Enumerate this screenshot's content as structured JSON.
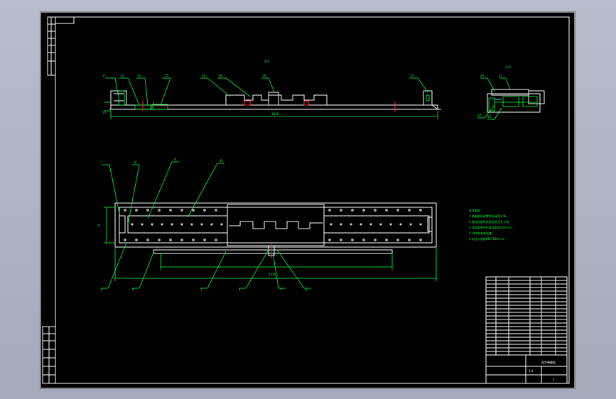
{
  "colors": {
    "background": "#000000",
    "outline": "#ffffff",
    "leader": "#00ff3c",
    "centerline": "#ff2a2a",
    "viewport": "#a9b0bf"
  },
  "top_view": {
    "section_label": "A-A",
    "part_callouts": [
      "17",
      "13",
      "14",
      "15",
      "16",
      "18",
      "19",
      "10",
      "13"
    ],
    "length_dim": "1426"
  },
  "side_section": {
    "label": "B-B",
    "part_callouts": [
      "20",
      "21",
      "22",
      "23"
    ]
  },
  "plan_view": {
    "part_callouts_top": [
      "2",
      "8",
      "9",
      "11"
    ],
    "part_callouts_bottom": [
      "4",
      "5",
      "1",
      "3",
      "7",
      "6"
    ],
    "left_dim": "B",
    "length_dim": "1426"
  },
  "tech_notes": {
    "title": "技术要求",
    "lines": [
      "1.装配前所有零件应清洗干净。",
      "2.各运动部件应运动灵活无卡滞。",
      "3.导轨安装平行度误差≤0.02mm。",
      "4.同步带张紧适度。",
      "5.未注公差按GB/T1804-m。"
    ]
  },
  "title_block": {
    "row_count": 22,
    "drawing_name": "同步带模组",
    "scale": "1:2",
    "sheet": "1"
  }
}
